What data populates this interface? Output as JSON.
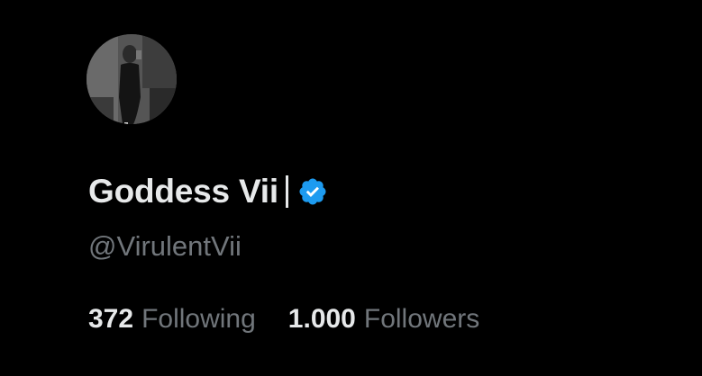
{
  "profile": {
    "display_name": "Goddess Vii",
    "name_separator": "|",
    "handle": "@VirulentVii",
    "verified": true,
    "avatar_icon": "profile-photo-avatar",
    "verified_icon": "verified-badge-icon"
  },
  "stats": {
    "following": {
      "count": "372",
      "label": "Following"
    },
    "followers": {
      "count": "1.000",
      "label": "Followers"
    }
  },
  "colors": {
    "background": "#000000",
    "primary_text": "#e7e9ea",
    "secondary_text": "#71767b",
    "verified_blue": "#1d9bf0"
  }
}
